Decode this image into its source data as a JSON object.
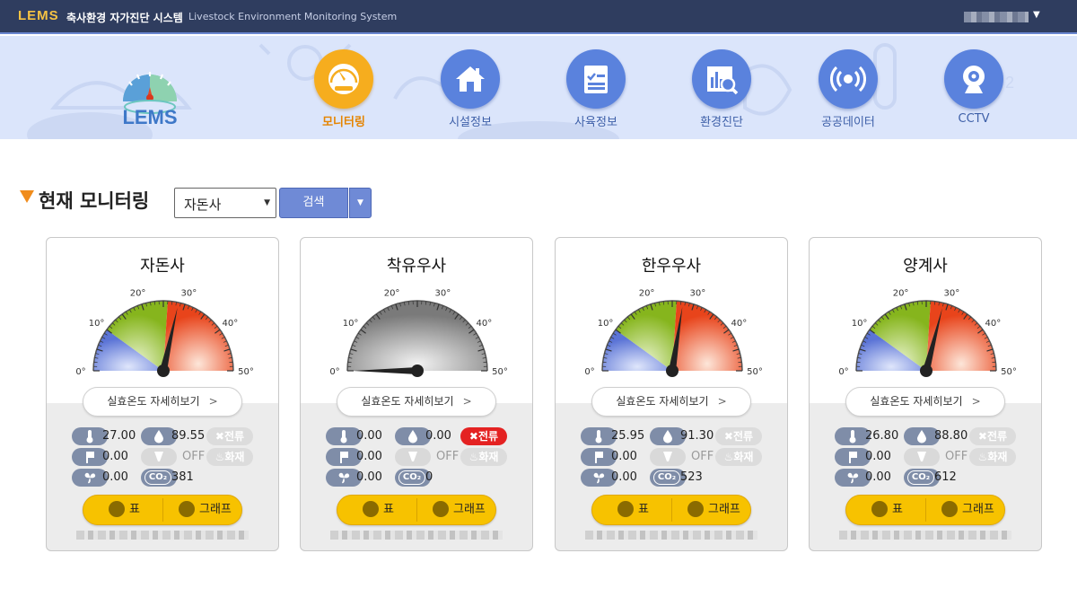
{
  "header": {
    "brand": "LEMS",
    "title_kr": "축사환경 자가진단 시스템",
    "title_en": "Livestock Environment Monitoring System"
  },
  "logo_text": "LEMS",
  "nav": [
    {
      "label": "모니터링",
      "icon": "gauge-icon",
      "active": true
    },
    {
      "label": "시설정보",
      "icon": "house-icon",
      "active": false
    },
    {
      "label": "사육정보",
      "icon": "clipboard-icon",
      "active": false
    },
    {
      "label": "환경진단",
      "icon": "chart-search-icon",
      "active": false
    },
    {
      "label": "공공데이터",
      "icon": "broadcast-icon",
      "active": false
    },
    {
      "label": "CCTV",
      "icon": "webcam-icon",
      "active": false
    }
  ],
  "section": {
    "title": "현재 모니터링",
    "select_value": "자돈사",
    "search_label": "검색"
  },
  "gauge_ticks": [
    "0°",
    "10°",
    "20°",
    "30°",
    "40°",
    "50°"
  ],
  "gauge_range": [
    0,
    50
  ],
  "detail_label": "실효온도 자세히보기",
  "buttons": {
    "table": "표",
    "graph": "그래프"
  },
  "labels": {
    "leak": "전류",
    "fire": "화재",
    "off": "OFF",
    "co2": "CO₂"
  },
  "colors": {
    "accent": "#f6ad1e",
    "nav_blue": "#5a82dd",
    "alert": "#e42222",
    "yellow_btn": "#f7c200"
  },
  "cards": [
    {
      "name": "자돈사",
      "effective_temp": 28.5,
      "gauge_gray": false,
      "temp": "27.00",
      "humidity": "89.55",
      "light": "0.00",
      "wind": "0.00",
      "co2": "381",
      "leak_alert": false
    },
    {
      "name": "착유우사",
      "effective_temp": 0,
      "gauge_gray": true,
      "temp": "0.00",
      "humidity": "0.00",
      "light": "0.00",
      "wind": "0.00",
      "co2": "0",
      "leak_alert": true
    },
    {
      "name": "한우우사",
      "effective_temp": 27.5,
      "gauge_gray": false,
      "temp": "25.95",
      "humidity": "91.30",
      "light": "0.00",
      "wind": "0.00",
      "co2": "523",
      "leak_alert": false
    },
    {
      "name": "양계사",
      "effective_temp": 29.0,
      "gauge_gray": false,
      "temp": "26.80",
      "humidity": "88.80",
      "light": "0.00",
      "wind": "0.00",
      "co2": "612",
      "leak_alert": false
    }
  ]
}
